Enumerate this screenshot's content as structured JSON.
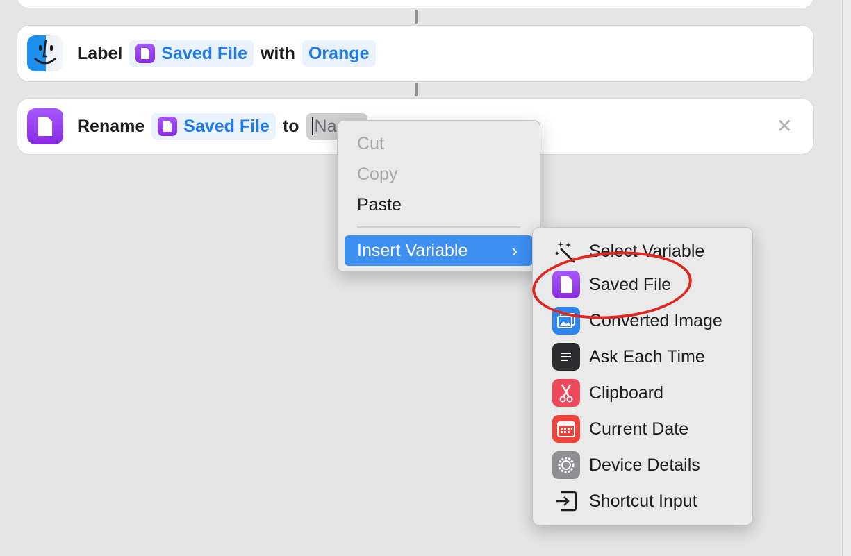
{
  "actions": {
    "label": {
      "verb": "Label",
      "variable": "Saved File",
      "connector": "with",
      "color": "Orange"
    },
    "rename": {
      "verb": "Rename",
      "variable": "Saved File",
      "connector": "to",
      "field_value": "Na"
    }
  },
  "context_menu": {
    "items": [
      {
        "label": "Cut",
        "enabled": false
      },
      {
        "label": "Copy",
        "enabled": false
      },
      {
        "label": "Paste",
        "enabled": true
      }
    ],
    "insert_variable": "Insert Variable"
  },
  "variable_menu": {
    "items": [
      {
        "label": "Select Variable",
        "icon": "magic-wand-icon"
      },
      {
        "label": "Saved File",
        "icon": "document-icon",
        "highlighted": true
      },
      {
        "label": "Converted Image",
        "icon": "photos-icon"
      },
      {
        "label": "Ask Each Time",
        "icon": "speech-bubble-icon"
      },
      {
        "label": "Clipboard",
        "icon": "scissors-icon"
      },
      {
        "label": "Current Date",
        "icon": "calendar-icon"
      },
      {
        "label": "Device Details",
        "icon": "gear-icon"
      },
      {
        "label": "Shortcut Input",
        "icon": "input-arrow-icon"
      }
    ]
  },
  "colors": {
    "accent": "#1f7aeb",
    "token_bg": "#eaf3fd",
    "purple": "#9b45f5",
    "menu_selected": "#3d8ff2",
    "annotation_ring": "#e0261e"
  }
}
